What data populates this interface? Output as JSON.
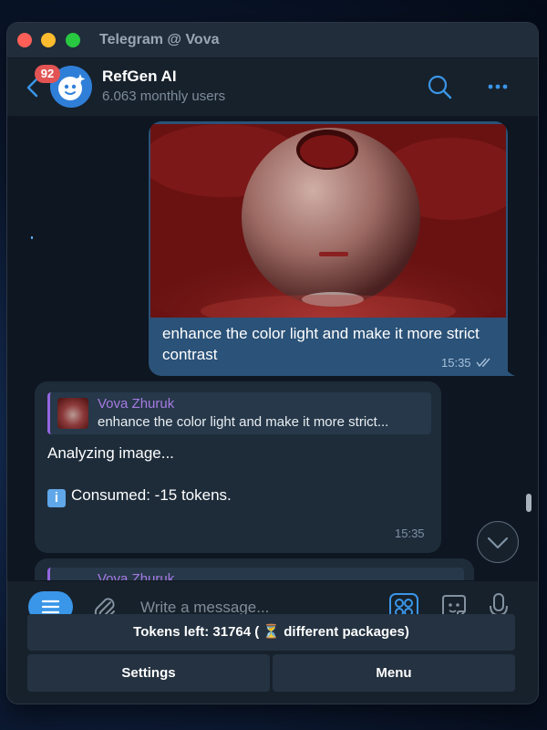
{
  "window": {
    "title": "Telegram @ Vova"
  },
  "header": {
    "unread_badge": "92",
    "chat_name": "RefGen AI",
    "chat_subtitle": "6.063 monthly users"
  },
  "messages": {
    "outgoing": {
      "text": "enhance the color light and make it more strict contrast",
      "time": "15:35"
    },
    "incoming": {
      "reply_author": "Vova Zhuruk",
      "reply_text": "enhance the color light and make it more strict...",
      "line1": "Analyzing image...",
      "consumed_icon": "i",
      "line2": "Consumed: -15 tokens.",
      "time": "15:35"
    },
    "incoming_partial": {
      "reply_author": "Vova Zhuruk"
    }
  },
  "composer": {
    "placeholder": "Write a message..."
  },
  "keyboard": {
    "tokens_label": "Tokens left: 31764 ( ⏳ different packages)",
    "settings_label": "Settings",
    "menu_label": "Menu"
  },
  "colors": {
    "accent": "#3a96e8",
    "outgoing_bubble": "#2b5278",
    "incoming_bubble": "#1e2c3a",
    "reply_name": "#a67be3",
    "badge": "#e25353"
  }
}
